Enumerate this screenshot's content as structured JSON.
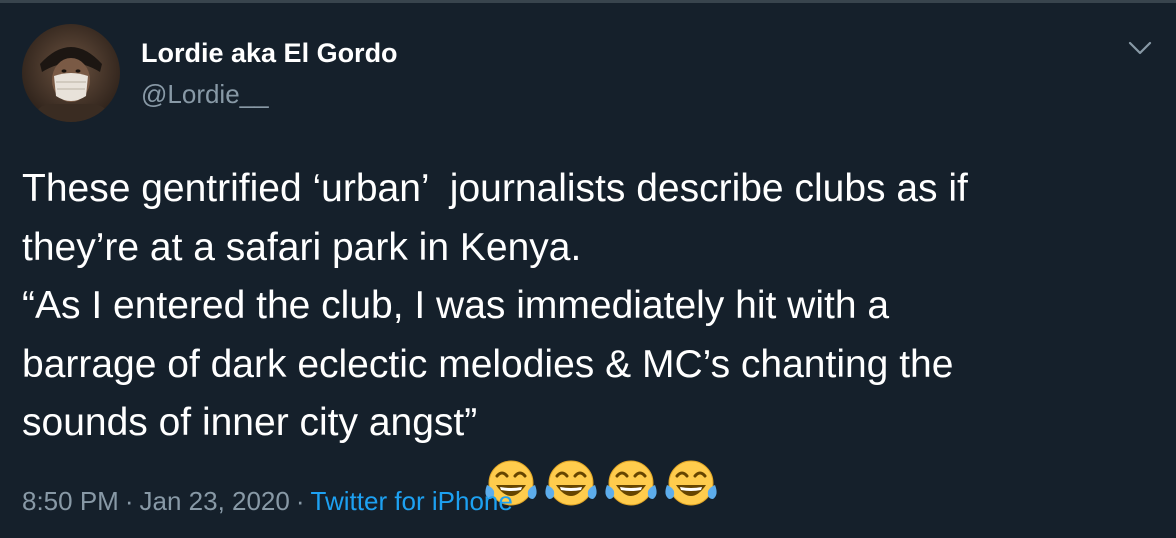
{
  "tweet": {
    "author": {
      "display_name": "Lordie aka El Gordo",
      "handle": "@Lordie__",
      "avatar_icon": "profile-photo-masked-person"
    },
    "menu_icon": "chevron-down-icon",
    "text_lines": [
      "These gentrified ‘urban’  journalists describe clubs as if",
      "they’re at a safari park in Kenya.",
      "“As I entered the club, I was immediately hit with a",
      "barrage of dark eclectic melodies & MC’s chanting the",
      "sounds of inner city angst”"
    ],
    "emojis": [
      "face-with-tears-of-joy",
      "face-with-tears-of-joy",
      "face-with-tears-of-joy",
      "face-with-tears-of-joy"
    ],
    "time": "8:50 PM",
    "separator": "·",
    "date": "Jan 23, 2020",
    "source": "Twitter for iPhone"
  },
  "colors": {
    "background": "#15202b",
    "secondary_text": "#8899a6",
    "link": "#1da1f2",
    "primary_text": "#ffffff"
  }
}
